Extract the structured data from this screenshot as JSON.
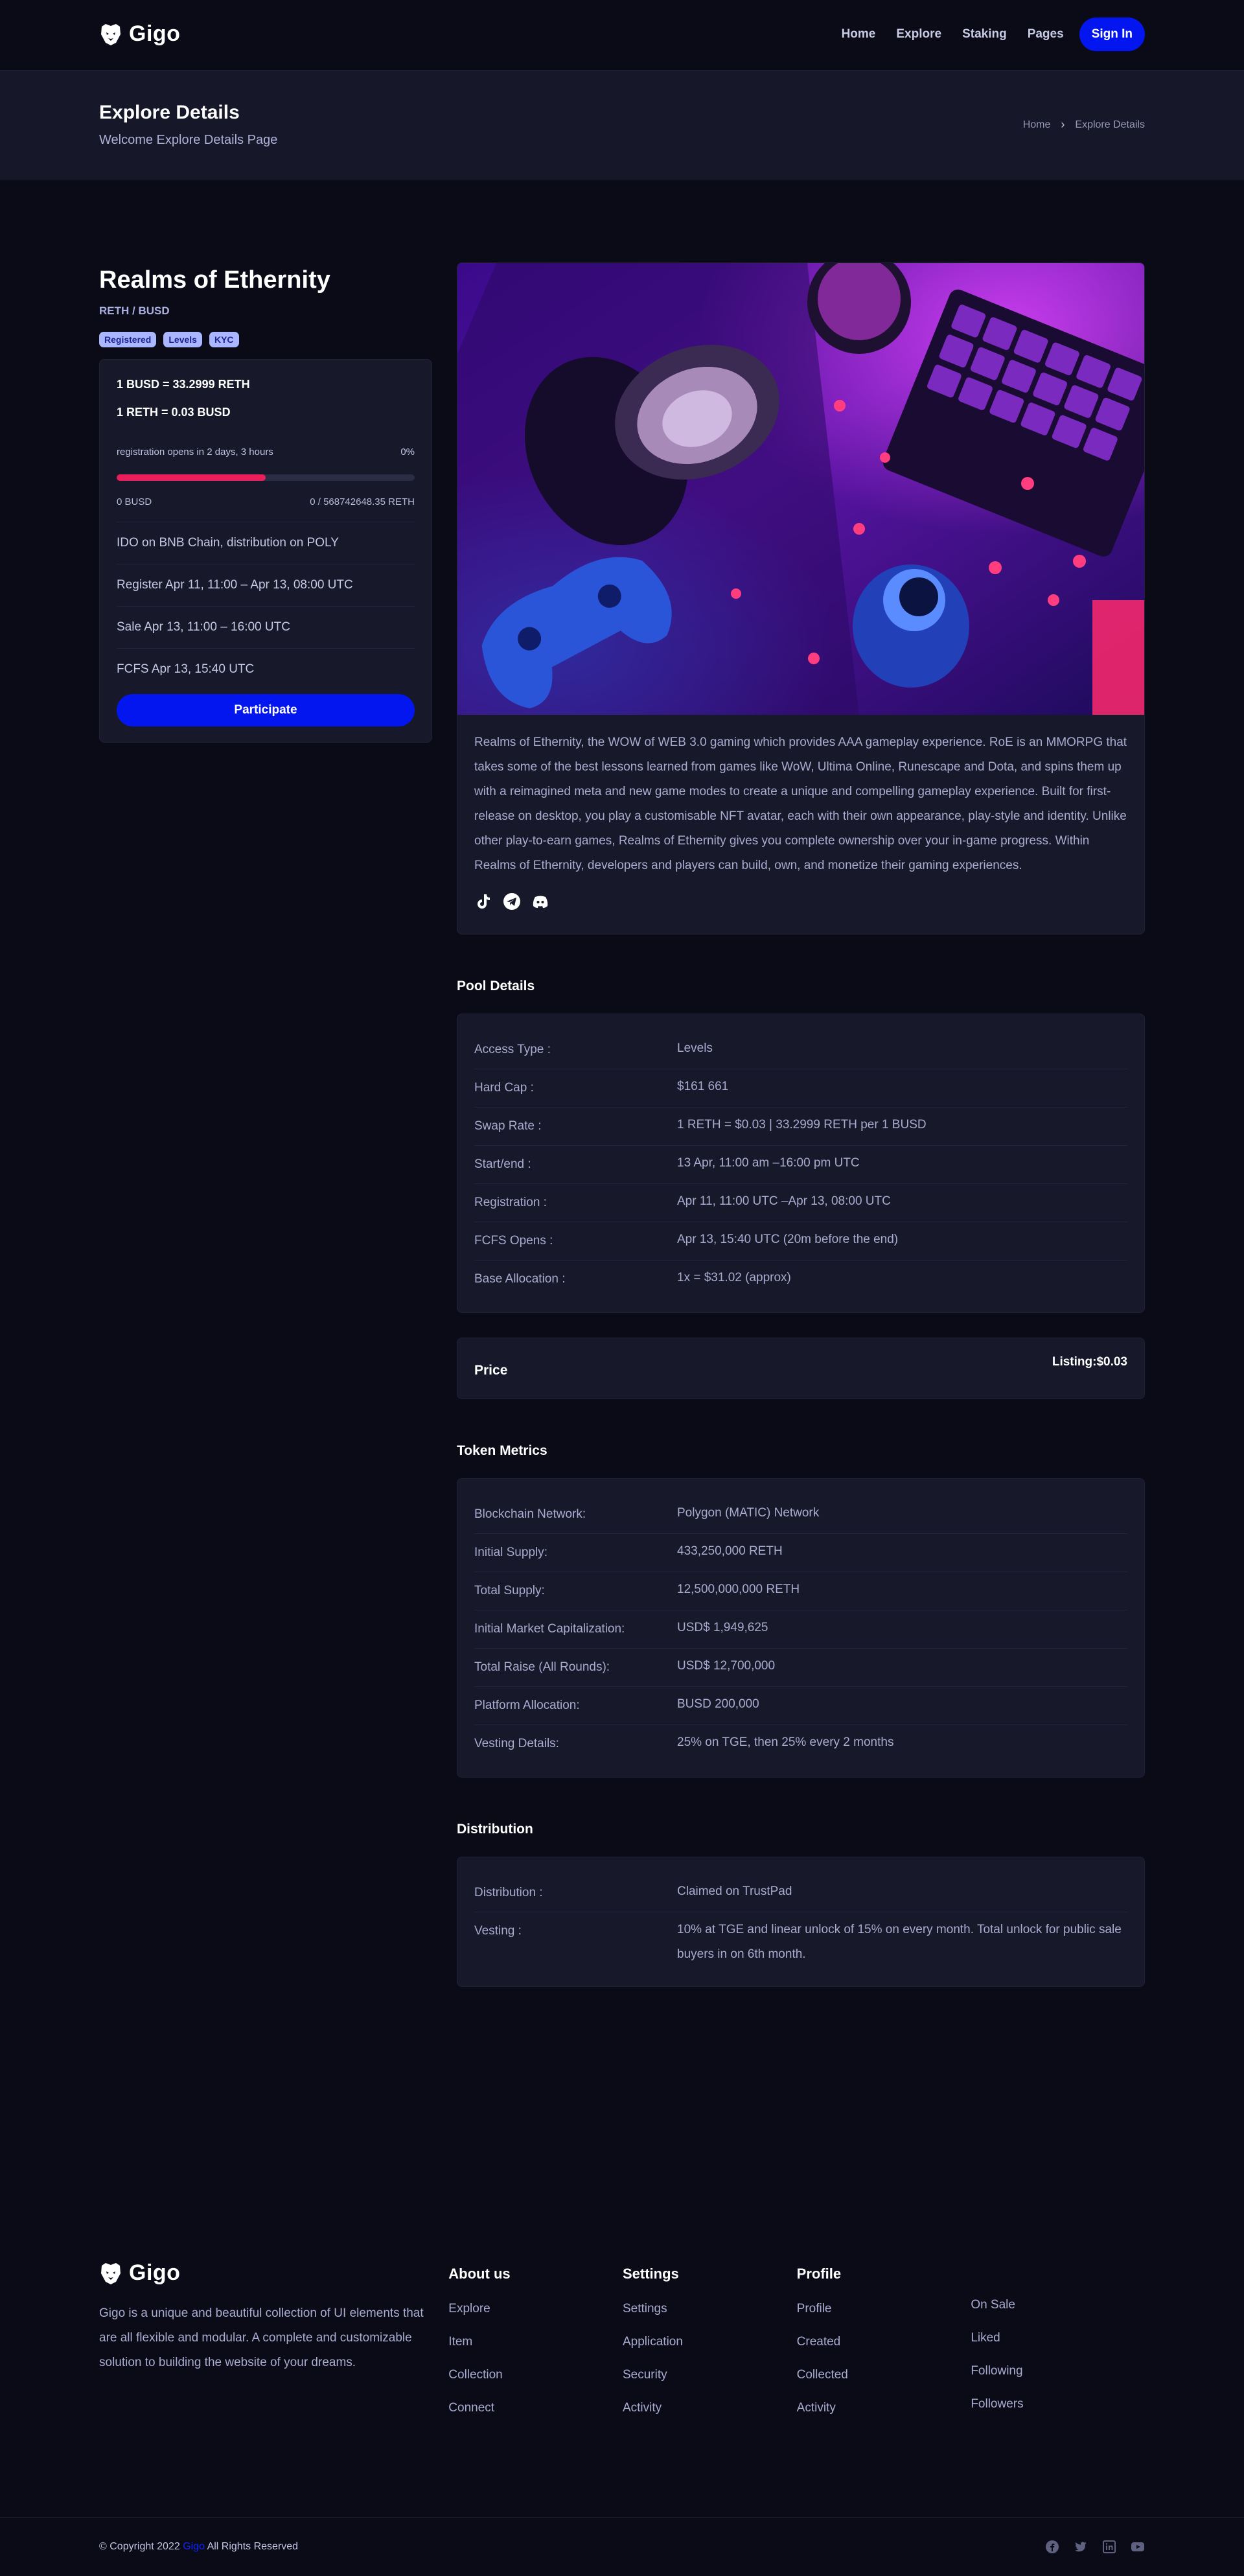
{
  "brand": {
    "name": "Gigo"
  },
  "nav": {
    "links": [
      "Home",
      "Explore",
      "Staking",
      "Pages"
    ],
    "signin": "Sign In"
  },
  "banner": {
    "title": "Explore Details",
    "subtitle": "Welcome Explore Details Page",
    "breadcrumb": [
      "Home",
      "Explore Details"
    ]
  },
  "project": {
    "title": "Realms of Ethernity",
    "pair": "RETH / BUSD",
    "tags": [
      "Registered",
      "Levels",
      "KYC"
    ],
    "rate1": "1 BUSD = 33.2999 RETH",
    "rate2": "1 RETH = 0.03 BUSD",
    "registration_text": "registration opens in 2 days, 3 hours",
    "progress_label": "0%",
    "progress_fraction": 0.5,
    "raised": "0 BUSD",
    "target": "0 / 568742648.35 RETH",
    "info": [
      "IDO on BNB Chain, distribution on POLY",
      "Register Apr 11, 11:00 – Apr 13, 08:00 UTC",
      "Sale Apr 13, 11:00 – 16:00 UTC",
      "FCFS Apr 13, 15:40 UTC"
    ],
    "participate": "Participate",
    "description": "Realms of Ethernity, the WOW of WEB 3.0 gaming which provides AAA gameplay experience. RoE is an MMORPG that takes some of the best lessons learned from games like WoW, Ultima Online, Runescape and Dota, and spins them up with a reimagined meta and new game modes to create a unique and compelling gameplay experience. Built for first-release on desktop, you play a customisable NFT avatar, each with their own appearance, play-style and identity. Unlike other play-to-earn games, Realms of Ethernity gives you complete ownership over your in-game progress. Within Realms of Ethernity, developers and players can build, own, and monetize their gaming experiences.",
    "socials": [
      "tiktok-icon",
      "telegram-icon",
      "discord-icon"
    ]
  },
  "pool": {
    "title": "Pool Details",
    "rows": [
      {
        "k": "Access Type :",
        "v": "Levels"
      },
      {
        "k": "Hard Cap :",
        "v": "$161 661"
      },
      {
        "k": "Swap Rate :",
        "v": "1 RETH = $0.03 | 33.2999 RETH per 1 BUSD"
      },
      {
        "k": "Start/end :",
        "v": "13 Apr, 11:00 am –16:00 pm UTC"
      },
      {
        "k": "Registration :",
        "v": "Apr 11, 11:00 UTC –Apr 13, 08:00 UTC"
      },
      {
        "k": "FCFS Opens :",
        "v": "Apr 13, 15:40 UTC (20m before the end)"
      },
      {
        "k": "Base Allocation :",
        "v": "1x = $31.02 (approx)"
      }
    ]
  },
  "price": {
    "label": "Price",
    "value": "Listing:$0.03"
  },
  "token": {
    "title": "Token Metrics",
    "rows": [
      {
        "k": "Blockchain Network:",
        "v": "Polygon (MATIC) Network"
      },
      {
        "k": "Initial Supply:",
        "v": "433,250,000 RETH"
      },
      {
        "k": "Total Supply:",
        "v": "12,500,000,000 RETH"
      },
      {
        "k": "Initial Market Capitalization:",
        "v": "USD$ 1,949,625"
      },
      {
        "k": "Total Raise (All Rounds):",
        "v": "USD$ 12,700,000"
      },
      {
        "k": "Platform Allocation:",
        "v": "BUSD 200,000"
      },
      {
        "k": "Vesting Details:",
        "v": "25% on TGE, then 25% every 2 months"
      }
    ]
  },
  "distribution": {
    "title": "Distribution",
    "rows": [
      {
        "k": "Distribution :",
        "v": "Claimed on TrustPad"
      },
      {
        "k": "Vesting :",
        "v": "10% at TGE and linear unlock of 15% on every month. Total unlock for public sale buyers in on 6th month."
      }
    ]
  },
  "footer": {
    "about": "Gigo is a unique and beautiful collection of UI elements that are all flexible and modular. A complete and customizable solution to building the website of your dreams.",
    "columns": [
      {
        "title": "About us",
        "links": [
          "Explore",
          "Item",
          "Collection",
          "Connect"
        ]
      },
      {
        "title": "Settings",
        "links": [
          "Settings",
          "Application",
          "Security",
          "Activity"
        ]
      },
      {
        "title": "Profile",
        "links": [
          "Profile",
          "Created",
          "Collected",
          "Activity"
        ]
      }
    ],
    "extra_links": [
      "On Sale",
      "Liked",
      "Following",
      "Followers"
    ],
    "copyright_pre": "© Copyright 2022",
    "copyright_brand": "Gigo",
    "copyright_post": "All Rights Reserved"
  },
  "colors": {
    "accent": "#0416f0",
    "progress": "#e91e5a",
    "background": "#0a0b17",
    "card": "#171829"
  }
}
